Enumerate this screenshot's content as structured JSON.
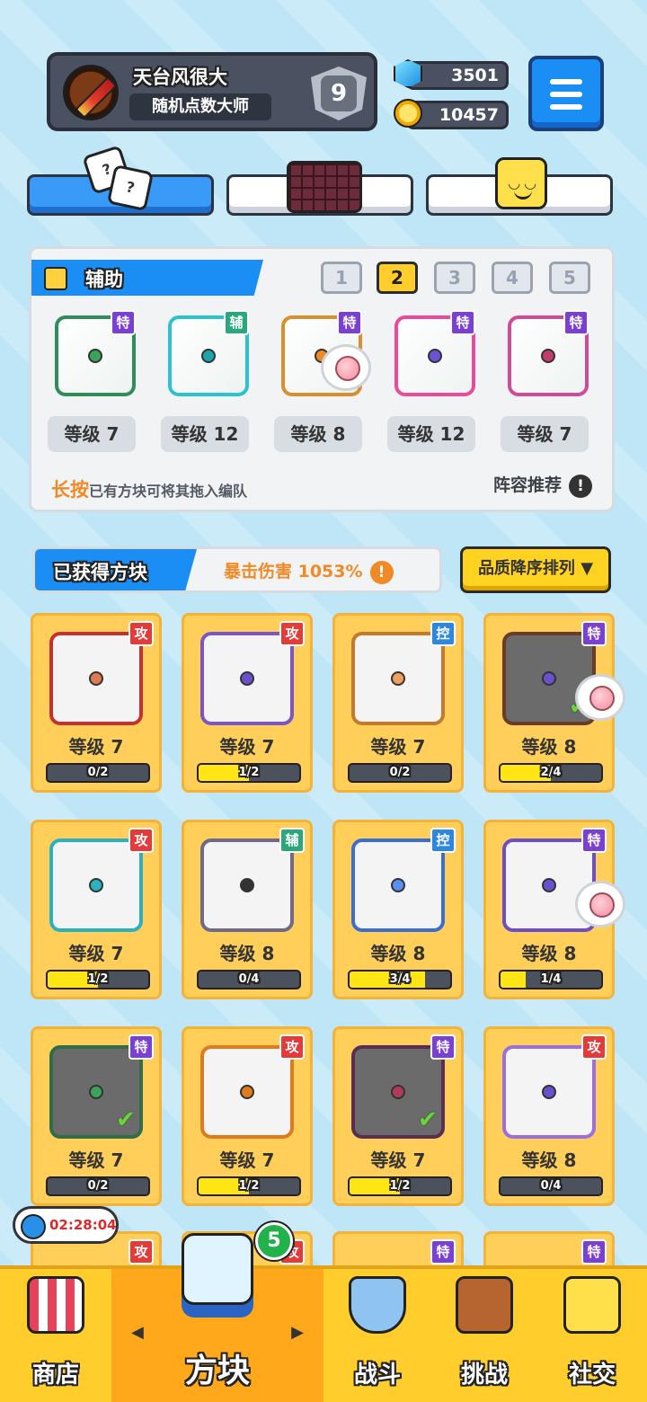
{
  "player": {
    "name": "天台风很大",
    "title": "随机点数大师",
    "rank": "9"
  },
  "currency": {
    "gems": "3501",
    "coins": "10457"
  },
  "colors": {
    "accent": "#1b8ef5",
    "gold": "#ffcd2c",
    "epic": "#7b3fd4",
    "support": "#2aa77b",
    "attack": "#e43a3a",
    "control": "#2a88e0"
  },
  "assist": {
    "title": "辅助",
    "pages": [
      "1",
      "2",
      "3",
      "4",
      "5"
    ],
    "active_page": "2",
    "slots": [
      {
        "tag": "特",
        "level": "等级 7",
        "color": "#2f8d5b",
        "pip": "#3aa35a"
      },
      {
        "tag": "辅",
        "level": "等级 12",
        "color": "#2cc2d0",
        "pip": "#1fa3ad"
      },
      {
        "tag": "特",
        "level": "等级 8",
        "color": "#d8902f",
        "pip": "#f08a26"
      },
      {
        "tag": "特",
        "level": "等级 12",
        "color": "#e94b9a",
        "pip": "#6b52d6"
      },
      {
        "tag": "特",
        "level": "等级 7",
        "color": "#d04a9a",
        "pip": "#c23a6e"
      }
    ],
    "hint_emph": "长按",
    "hint_rest": "已有方块可将其拖入编队",
    "recommend": "阵容推荐",
    "excl": "!"
  },
  "obtained": {
    "title": "已获得方块",
    "crit": "暴击伤害 1053%",
    "sort": "品质降序排列 ▼"
  },
  "cards": [
    {
      "tag": "攻",
      "level": "等级 7",
      "progress": "0/2",
      "fill": 0,
      "color": "#c73030",
      "pip": "#e07a52",
      "check": false
    },
    {
      "tag": "攻",
      "level": "等级 7",
      "progress": "1/2",
      "fill": 0.5,
      "color": "#7a55c9",
      "pip": "#6a4fd0",
      "check": false
    },
    {
      "tag": "控",
      "level": "等级 7",
      "progress": "0/2",
      "fill": 0,
      "color": "#c47a2c",
      "pip": "#f0a060",
      "check": false
    },
    {
      "tag": "特",
      "level": "等级 8",
      "progress": "2/4",
      "fill": 0.5,
      "color": "#6b3b2a",
      "pip": "#6a4fd0",
      "check": true
    },
    {
      "tag": "攻",
      "level": "等级 7",
      "progress": "1/2",
      "fill": 0.5,
      "color": "#2cb0bf",
      "pip": "#28b3bf",
      "check": false
    },
    {
      "tag": "辅",
      "level": "等级 8",
      "progress": "0/4",
      "fill": 0,
      "color": "#6f6a8a",
      "pip": "#333333",
      "check": false
    },
    {
      "tag": "控",
      "level": "等级 8",
      "progress": "3/4",
      "fill": 0.75,
      "color": "#3a6fd0",
      "pip": "#5a8ef0",
      "check": false
    },
    {
      "tag": "特",
      "level": "等级 8",
      "progress": "1/4",
      "fill": 0.25,
      "color": "#6a4fc9",
      "pip": "#6a4fd0",
      "check": false
    },
    {
      "tag": "特",
      "level": "等级 7",
      "progress": "0/2",
      "fill": 0,
      "color": "#2f6d4b",
      "pip": "#3aa35a",
      "check": true
    },
    {
      "tag": "攻",
      "level": "等级 7",
      "progress": "1/2",
      "fill": 0.5,
      "color": "#e07a1f",
      "pip": "#e07a1f",
      "check": false
    },
    {
      "tag": "特",
      "level": "等级 7",
      "progress": "1/2",
      "fill": 0.5,
      "color": "#5a2d55",
      "pip": "#b03a5a",
      "check": true
    },
    {
      "tag": "攻",
      "level": "等级 8",
      "progress": "0/4",
      "fill": 0,
      "color": "#9a70e0",
      "pip": "#6a4fd0",
      "check": false
    }
  ],
  "partial_tags": [
    "攻",
    "攻",
    "特",
    "特"
  ],
  "timer": "02:28:04",
  "badge": "5",
  "nav": {
    "shop": "商店",
    "dice": "方块",
    "battle": "战斗",
    "challenge": "挑战",
    "social": "社交",
    "left_arrow": "◀",
    "right_arrow": "▶"
  }
}
